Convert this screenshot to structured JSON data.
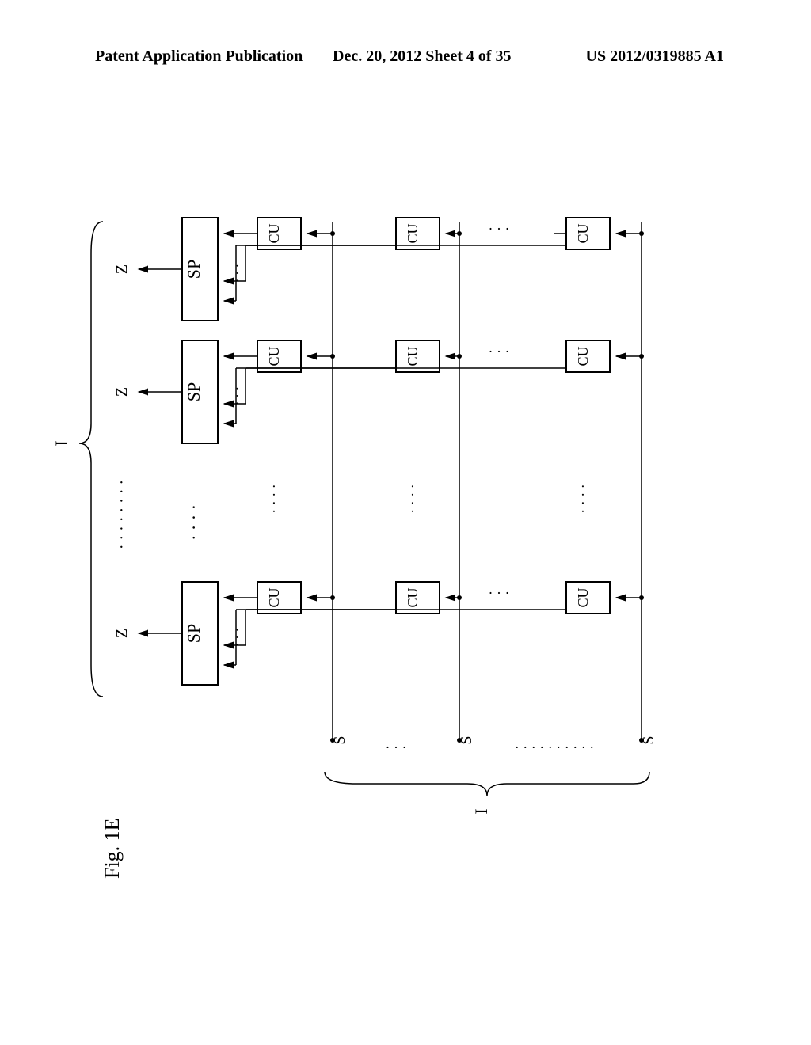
{
  "header": {
    "left": "Patent Application Publication",
    "mid": "Dec. 20, 2012  Sheet 4 of 35",
    "right": "US 2012/0319885 A1"
  },
  "labels": {
    "cu": "CU",
    "sp": "SP",
    "s": "S",
    "z": "Z",
    "i_bottom": "I",
    "i_left": "I",
    "fig": "Fig. 1E"
  }
}
